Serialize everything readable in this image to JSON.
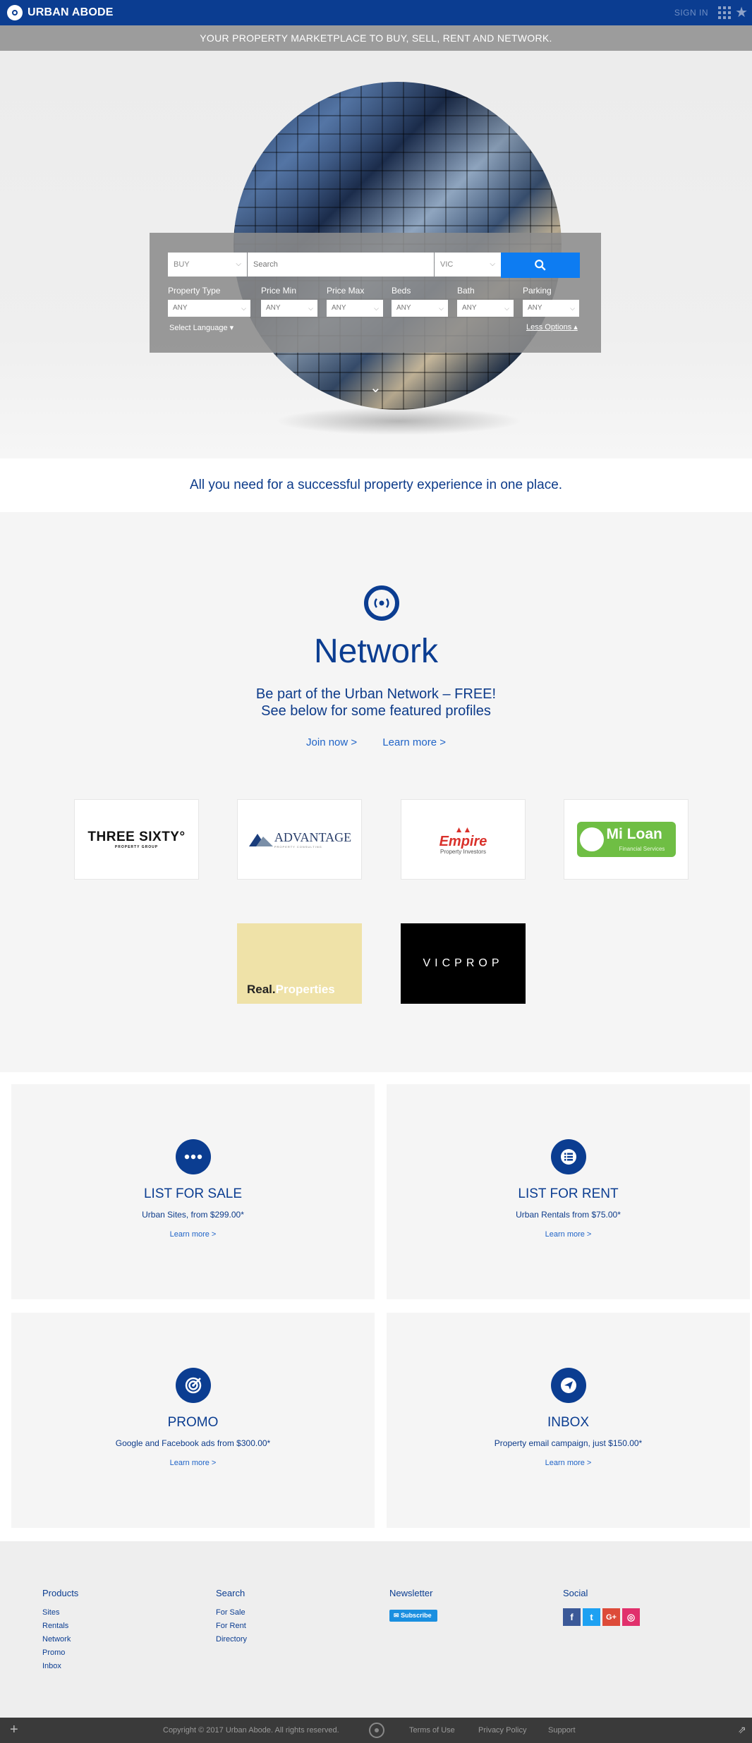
{
  "header": {
    "brand": "URBAN ABODE",
    "sign_in": "SIGN IN",
    "tagline": "YOUR PROPERTY MARKETPLACE TO BUY, SELL, RENT AND NETWORK."
  },
  "search": {
    "mode": "BUY",
    "placeholder": "Search",
    "state": "VIC",
    "labels": [
      "Property Type",
      "Price Min",
      "Price Max",
      "Beds",
      "Bath",
      "Parking"
    ],
    "any": "ANY",
    "language": "Select Language",
    "less_options": "Less Options"
  },
  "subheadline": "All you need for a successful property experience in one place.",
  "network": {
    "title": "Network",
    "line1": "Be part of the Urban Network – FREE!",
    "line2": "See below for some featured profiles",
    "join": "Join now >",
    "learn": "Learn more >",
    "profiles": {
      "three_sixty": "THREE SIXTY°",
      "three_sixty_sub": "PROPERTY GROUP",
      "advantage": "ADVANTAGE",
      "advantage_sub": "PROPERTY CONSULTING",
      "empire": "Empire",
      "empire_sub": "Property Investors",
      "miloan": "Mi Loan",
      "miloan_sub": "Financial Services",
      "real_a": "Real.",
      "real_b": "Properties",
      "vicprop": "VICPROP"
    }
  },
  "cards": [
    {
      "title": "LIST FOR SALE",
      "desc": "Urban Sites, from $299.00*",
      "link": "Learn more >"
    },
    {
      "title": "LIST FOR RENT",
      "desc": "Urban Rentals from $75.00*",
      "link": "Learn more >"
    },
    {
      "title": "PROMO",
      "desc": "Google and Facebook ads from $300.00*",
      "link": "Learn more >"
    },
    {
      "title": "INBOX",
      "desc": "Property email campaign, just $150.00*",
      "link": "Learn more >"
    }
  ],
  "footer": {
    "products_title": "Products",
    "products": [
      "Sites",
      "Rentals",
      "Network",
      "Promo",
      "Inbox"
    ],
    "search_title": "Search",
    "search": [
      "For Sale",
      "For Rent",
      "Directory"
    ],
    "newsletter_title": "Newsletter",
    "subscribe": "Subscribe",
    "social_title": "Social",
    "social": {
      "facebook": "f",
      "twitter": "t",
      "google": "G+",
      "instagram": "◎"
    },
    "copyright": "Copyright © 2017 Urban Abode. All rights reserved.",
    "terms": "Terms of Use",
    "privacy": "Privacy Policy",
    "support": "Support"
  },
  "colors": {
    "brand": "#0b3d91",
    "accent": "#0d7cf2",
    "link": "#1f63c7"
  }
}
